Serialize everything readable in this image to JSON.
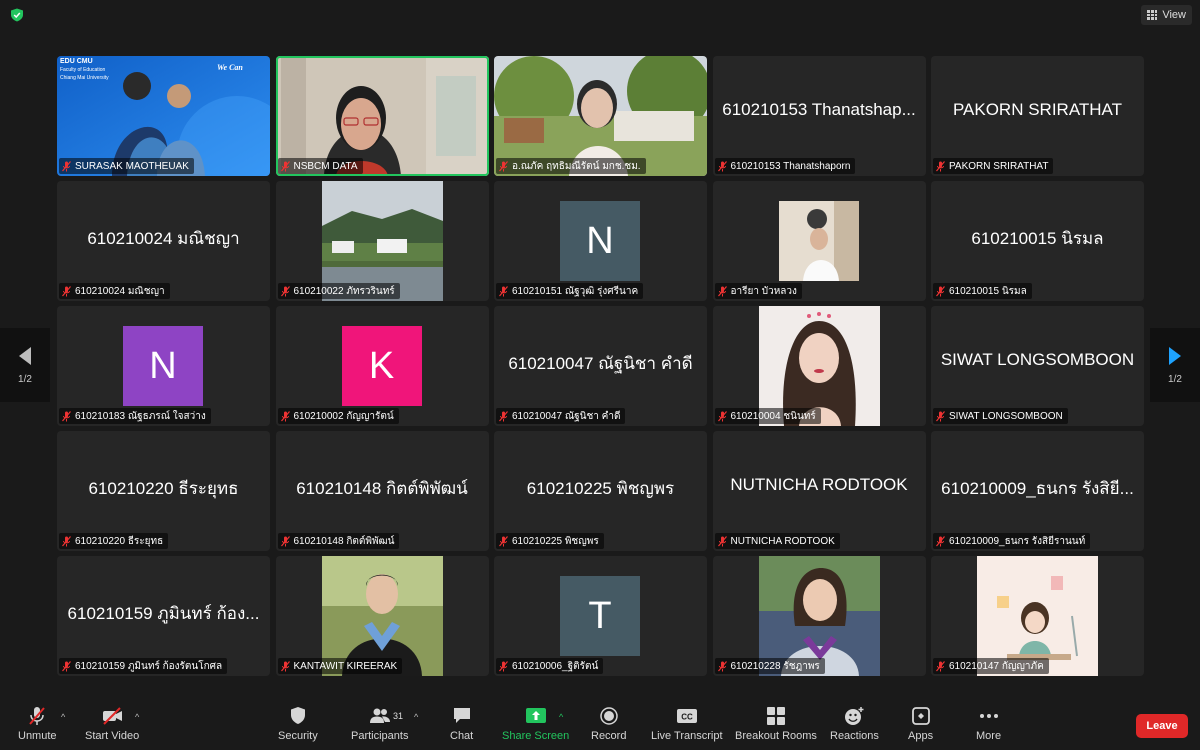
{
  "topbar": {
    "view_label": "View"
  },
  "pager": {
    "left_label": "1/2",
    "right_label": "1/2"
  },
  "colors": {
    "accent_green": "#22c55e",
    "leave_red": "#e02828",
    "arrow_blue": "#1ea3ff"
  },
  "tiles": [
    {
      "name": "SURASAK MAOTHEUAK",
      "display": "",
      "kind": "video",
      "scene": "slide"
    },
    {
      "name": "NSBCM DATA",
      "display": "",
      "kind": "video",
      "scene": "woman",
      "active": true
    },
    {
      "name": "อ.ณภัค ฤทธิมณีรัตน์ มกช.ชม.",
      "display": "",
      "kind": "video",
      "scene": "garden"
    },
    {
      "name": "610210153 Thanatshaporn",
      "display": "610210153 Thanatshap...",
      "kind": "text"
    },
    {
      "name": "PAKORN SRIRATHAT",
      "display": "PAKORN SRIRATHAT",
      "kind": "text"
    },
    {
      "name": "610210024 มณิชญา",
      "display": "610210024 มณิชญา",
      "kind": "text"
    },
    {
      "name": "610210022 ภัทรวรินทร์",
      "display": "",
      "kind": "photo",
      "scene": "landscape"
    },
    {
      "name": "610210151 ณัฐวุฒิ รุ่งศรีนาค",
      "display": "",
      "kind": "avatar",
      "letter": "N",
      "color": "#455a64"
    },
    {
      "name": "อารียา บัวหลวง",
      "display": "",
      "kind": "photo",
      "scene": "girl-small"
    },
    {
      "name": "610210015 นิรมล",
      "display": "610210015 นิรมล",
      "kind": "text"
    },
    {
      "name": "610210183 ณัฐธภรณ์ ใจสว่าง",
      "display": "",
      "kind": "avatar",
      "letter": "N",
      "color": "#8e44c4"
    },
    {
      "name": "610210002 กัญญารัตน์",
      "display": "",
      "kind": "avatar",
      "letter": "K",
      "color": "#f0157a"
    },
    {
      "name": "610210047 ณัฐนิชา คำดี",
      "display": "610210047 ณัฐนิชา คำดี",
      "kind": "text"
    },
    {
      "name": "610210004 ชนินทร์",
      "display": "",
      "kind": "photo",
      "scene": "portrait-girl"
    },
    {
      "name": "SIWAT LONGSOMBOON",
      "display": "SIWAT LONGSOMBOON",
      "kind": "text"
    },
    {
      "name": "610210220 ธีระยุทธ",
      "display": "610210220 ธีระยุทธ",
      "kind": "text"
    },
    {
      "name": "610210148 กิตต์พิพัฒน์",
      "display": "610210148 กิตต์พิพัฒน์",
      "kind": "text"
    },
    {
      "name": "610210225 พิชญพร",
      "display": "610210225 พิชญพร",
      "kind": "text"
    },
    {
      "name": "NUTNICHA RODTOOK",
      "display": "NUTNICHA RODTOOK",
      "kind": "text"
    },
    {
      "name": "610210009_ธนกร รังสิยีรานนท์",
      "display": "610210009_ธนกร รังสิยี...",
      "kind": "text"
    },
    {
      "name": "610210159 ภูมินทร์ ก้องรัตนโกศล",
      "display": "610210159 ภูมินทร์ ก้อง...",
      "kind": "text"
    },
    {
      "name": "KANTAWIT KIREERAK",
      "display": "",
      "kind": "photo",
      "scene": "graduate"
    },
    {
      "name": "610210006_ฐิติรัตน์",
      "display": "",
      "kind": "avatar",
      "letter": "T",
      "color": "#455a64"
    },
    {
      "name": "610210228 รัชฎาพร",
      "display": "",
      "kind": "photo",
      "scene": "student"
    },
    {
      "name": "610210147 กัญญาภัค",
      "display": "",
      "kind": "photo",
      "scene": "cartoon"
    }
  ],
  "slide_text": {
    "brand": "EDU CMU",
    "sub1": "Faculty of Education",
    "sub2": "Chiang Mai University",
    "tagline": "We Can"
  },
  "toolbar": {
    "unmute": "Unmute",
    "start_video": "Start Video",
    "security": "Security",
    "participants": "Participants",
    "participants_count": "31",
    "chat": "Chat",
    "share_screen": "Share Screen",
    "record": "Record",
    "live_transcript": "Live Transcript",
    "breakout_rooms": "Breakout Rooms",
    "reactions": "Reactions",
    "apps": "Apps",
    "more": "More",
    "leave": "Leave"
  }
}
